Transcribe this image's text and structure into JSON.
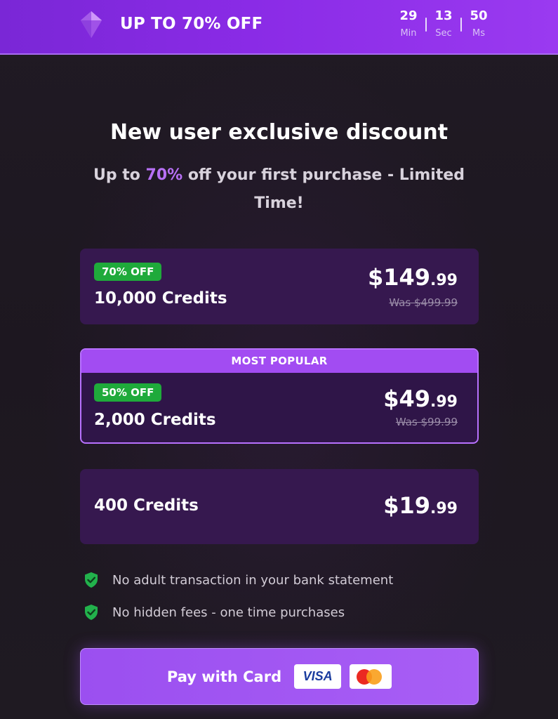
{
  "banner": {
    "title": "UP TO 70% OFF",
    "icon": "gem-icon",
    "timer": [
      {
        "value": "29",
        "label": "Min"
      },
      {
        "value": "13",
        "label": "Sec"
      },
      {
        "value": "50",
        "label": "Ms"
      }
    ]
  },
  "headline": "New user exclusive discount",
  "subline": {
    "pre": "Up to ",
    "accent": "70%",
    "post": " off your first purchase - Limited Time!"
  },
  "plans": [
    {
      "badge": "70% OFF",
      "credits": "10,000 Credits",
      "price_main": "$149",
      "price_cents": ".99",
      "was": "Was $499.99"
    },
    {
      "ribbon": "MOST POPULAR",
      "badge": "50% OFF",
      "credits": "2,000 Credits",
      "price_main": "$49",
      "price_cents": ".99",
      "was": "Was $99.99"
    },
    {
      "credits": "400 Credits",
      "price_main": "$19",
      "price_cents": ".99"
    }
  ],
  "features": [
    {
      "icon": "shield-check-icon",
      "text": "No adult transaction in your bank statement"
    },
    {
      "icon": "shield-check-icon",
      "text": "No hidden fees - one time purchases"
    }
  ],
  "pay": {
    "label": "Pay with Card",
    "visa": "VISA"
  },
  "colors": {
    "banner": "#8a2be6",
    "accent": "#b770f5",
    "card": "#36184f",
    "badge": "#1faa3b",
    "pay_button": "#a257f2"
  }
}
